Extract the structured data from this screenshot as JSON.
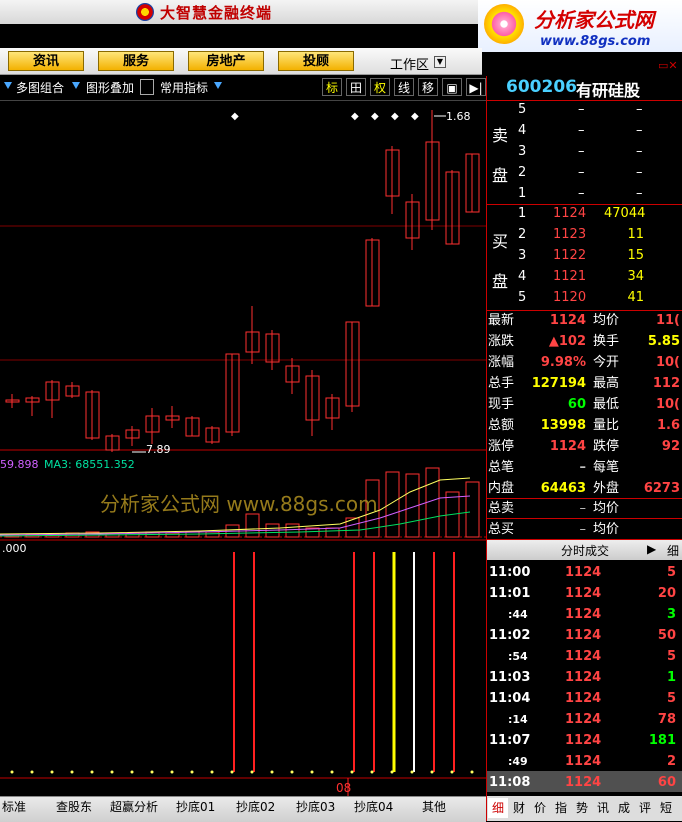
{
  "app": {
    "title": "大智慧金融终端"
  },
  "banner": {
    "title": "分析家公式网",
    "url": "www.88gs.com"
  },
  "menu": {
    "items": [
      "资讯",
      "服务",
      "房地产",
      "投顾"
    ],
    "workspace": "工作区"
  },
  "toolbar": {
    "multi_chart": "多图组合",
    "overlay": "图形叠加",
    "indicators": "常用指标",
    "buttons": [
      "标",
      "田",
      "权",
      "线",
      "移",
      "▣",
      "▶|"
    ]
  },
  "stock": {
    "code": "600206",
    "name": "有研硅股"
  },
  "sell": {
    "label_top": "卖",
    "label_bottom": "盘",
    "levels": [
      {
        "n": "5",
        "price": "–",
        "vol": "–"
      },
      {
        "n": "4",
        "price": "–",
        "vol": "–"
      },
      {
        "n": "3",
        "price": "–",
        "vol": "–"
      },
      {
        "n": "2",
        "price": "–",
        "vol": "–"
      },
      {
        "n": "1",
        "price": "–",
        "vol": "–"
      }
    ]
  },
  "buy": {
    "label_top": "买",
    "label_bottom": "盘",
    "levels": [
      {
        "n": "1",
        "price": "1124",
        "vol": "47044"
      },
      {
        "n": "2",
        "price": "1123",
        "vol": "11"
      },
      {
        "n": "3",
        "price": "1122",
        "vol": "15"
      },
      {
        "n": "4",
        "price": "1121",
        "vol": "34"
      },
      {
        "n": "5",
        "price": "1120",
        "vol": "41"
      }
    ]
  },
  "quote": [
    {
      "l1": "最新",
      "v1": "1124",
      "l2": "均价",
      "v2": "11("
    },
    {
      "l1": "涨跌",
      "v1": "▲102",
      "l2": "换手",
      "v2": "5.85"
    },
    {
      "l1": "涨幅",
      "v1": "9.98%",
      "l2": "今开",
      "v2": "10("
    },
    {
      "l1": "总手",
      "v1": "127194",
      "l2": "最高",
      "v2": "112"
    },
    {
      "l1": "现手",
      "v1": "60",
      "l2": "最低",
      "v2": "10("
    },
    {
      "l1": "总额",
      "v1": "13998",
      "l2": "量比",
      "v2": "1.6"
    },
    {
      "l1": "涨停",
      "v1": "1124",
      "l2": "跌停",
      "v2": "92"
    },
    {
      "l1": "总笔",
      "v1": "–",
      "l2": "每笔",
      "v2": ""
    },
    {
      "l1": "内盘",
      "v1": "64463",
      "l2": "外盘",
      "v2": "6273"
    }
  ],
  "totals": [
    {
      "l1": "总卖",
      "v1": "–",
      "l2": "均价",
      "v2": ""
    },
    {
      "l1": "总买",
      "v1": "–",
      "l2": "均价",
      "v2": ""
    }
  ],
  "trades_title": "分时成交",
  "trades_more": "细",
  "trades": [
    {
      "t": "11:00",
      "p": "1124",
      "v": "5"
    },
    {
      "t": "11:01",
      "p": "1124",
      "v": "20"
    },
    {
      "t": ":44",
      "p": "1124",
      "v": "3"
    },
    {
      "t": "11:02",
      "p": "1124",
      "v": "50"
    },
    {
      "t": ":54",
      "p": "1124",
      "v": "5"
    },
    {
      "t": "11:03",
      "p": "1124",
      "v": "1"
    },
    {
      "t": "11:04",
      "p": "1124",
      "v": "5"
    },
    {
      "t": ":14",
      "p": "1124",
      "v": "78"
    },
    {
      "t": "11:07",
      "p": "1124",
      "v": "181"
    },
    {
      "t": ":49",
      "p": "1124",
      "v": "2"
    },
    {
      "t": "11:08",
      "p": "1124",
      "v": "60"
    }
  ],
  "chart": {
    "high_label": "1.68",
    "low_label": "7.89",
    "ma_text1": "59.898",
    "ma_text2": "MA3: 68551.352",
    "indicator_label": ".000",
    "date_label": "08",
    "watermark": "分析家公式网  www.88gs.com"
  },
  "bottom_tabs": [
    "标准",
    "查股东",
    "超赢分析",
    "抄底01",
    "抄底02",
    "抄底03",
    "抄底04",
    "其他"
  ],
  "right_tabs": [
    "细",
    "财",
    "价",
    "指",
    "势",
    "讯",
    "成",
    "评",
    "短"
  ]
}
